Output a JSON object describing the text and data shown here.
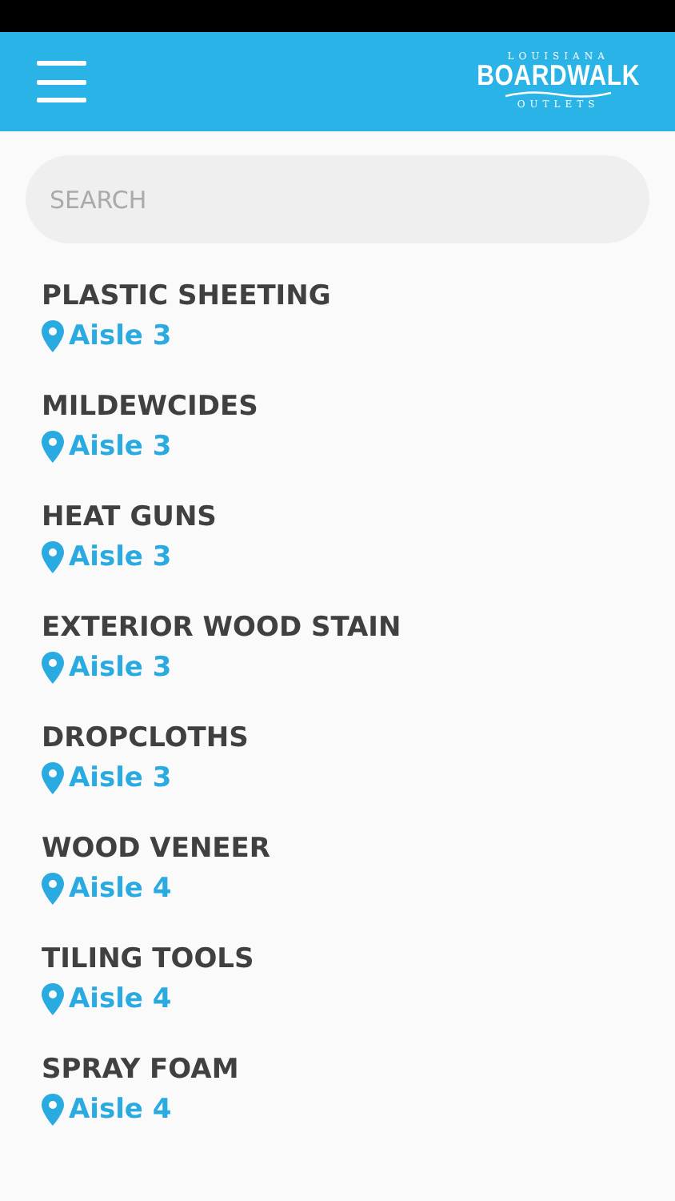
{
  "header": {
    "logo": {
      "top": "LOUISIANA",
      "main": "BOARDWALK",
      "bottom": "OUTLETS"
    }
  },
  "search": {
    "placeholder": "SEARCH"
  },
  "items": [
    {
      "name": "PLASTIC SHEETING",
      "location": "Aisle 3"
    },
    {
      "name": "MILDEWCIDES",
      "location": "Aisle 3"
    },
    {
      "name": "HEAT GUNS",
      "location": "Aisle 3"
    },
    {
      "name": "EXTERIOR WOOD STAIN",
      "location": "Aisle 3"
    },
    {
      "name": "DROPCLOTHS",
      "location": "Aisle 3"
    },
    {
      "name": "WOOD VENEER",
      "location": "Aisle 4"
    },
    {
      "name": "TILING TOOLS",
      "location": "Aisle 4"
    },
    {
      "name": "SPRAY FOAM",
      "location": "Aisle 4"
    }
  ]
}
